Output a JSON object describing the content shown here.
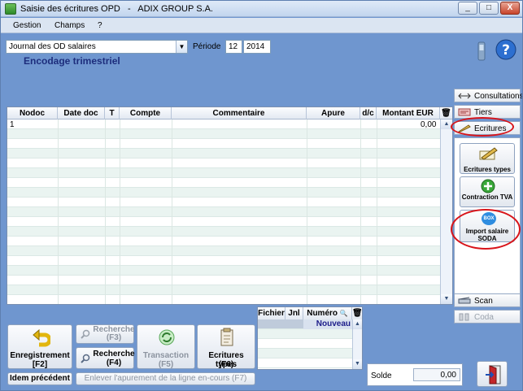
{
  "window": {
    "title": "Saisie des écritures OPD   -   ADIX GROUP S.A.",
    "minimize": "_",
    "maximize": "□",
    "close": "X"
  },
  "menu": [
    "Gestion",
    "Champs",
    "?"
  ],
  "header": {
    "journal": "Journal des OD salaires",
    "periode_label": "Période",
    "periode_month": "12",
    "periode_year": "2014",
    "subtitle": "Encodage trimestriel"
  },
  "grid": {
    "columns": [
      "Nodoc",
      "Date doc",
      "T",
      "Compte",
      "Commentaire",
      "Apure",
      "d/c",
      "Montant EUR"
    ],
    "first_row": {
      "nodoc": "1",
      "montant": "0,00"
    }
  },
  "right_panel": {
    "tabs": [
      "Consultations",
      "Tiers",
      "Ecritures",
      "Scan",
      "Coda"
    ],
    "buttons": [
      {
        "label": "Ecritures types"
      },
      {
        "label": "Contraction TVA"
      },
      {
        "label": "Import salaire SODA",
        "badge": "BOX"
      }
    ]
  },
  "bottom": {
    "enregistrement": "Enregistrement",
    "enregistrement_key": "[F2]",
    "recherche_f3": "Recherche",
    "recherche_f3_key": "(F3)",
    "recherche_f4": "Recherche",
    "recherche_f4_key": "(F4)",
    "transaction": "Transaction",
    "transaction_key": "(F5)",
    "ecritures_types": "Ecritures types",
    "ecritures_types_key": "(F6)",
    "idem_precedent": "Idem précédent",
    "enlever": "Enlever l'apurement de la ligne en-cours (F7)"
  },
  "file_grid": {
    "columns": [
      "Fichier",
      "Jnl",
      "Numéro"
    ],
    "first_row_numero": "Nouveau"
  },
  "solde": {
    "label": "Solde",
    "value": "0,00"
  },
  "colors": {
    "window_bg": "#6f96cf",
    "highlight_ring": "#d8141a",
    "accent_text": "#1d2d7c"
  }
}
